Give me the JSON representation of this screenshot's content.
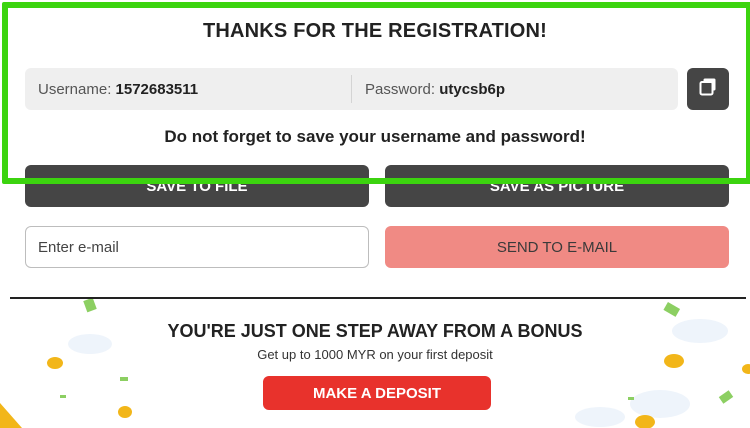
{
  "registration": {
    "title": "THANKS FOR THE REGISTRATION!",
    "username_label": "Username:",
    "username_value": "1572683511",
    "password_label": "Password:",
    "password_value": "utycsb6p",
    "warning": "Do not forget to save your username and password!"
  },
  "actions": {
    "save_to_file": "SAVE TO FILE",
    "save_as_picture": "SAVE AS PICTURE",
    "email_placeholder": "Enter e-mail",
    "send_to_email": "SEND TO E-MAIL"
  },
  "bonus": {
    "title": "YOU'RE JUST ONE STEP AWAY FROM A BONUS",
    "subtitle": "Get up to 1000 MYR on your first deposit",
    "deposit_button": "MAKE A DEPOSIT"
  },
  "colors": {
    "highlight": "#3cd40f",
    "dark_button": "#454545",
    "send_button": "#f08a84",
    "deposit_button": "#e8322c"
  },
  "icons": {
    "copy": "copy-icon",
    "coin": "coin-icon",
    "banknote": "banknote-icon",
    "cloud": "cloud-icon"
  }
}
